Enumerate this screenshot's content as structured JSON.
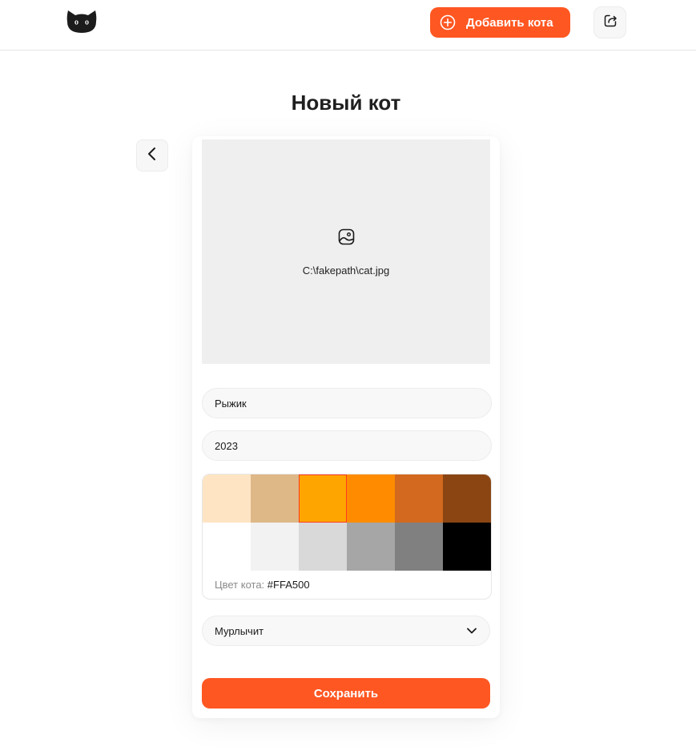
{
  "header": {
    "logo_icon": "cat-head-icon",
    "add_cat_label": "Добавить кота",
    "add_icon": "plus-circle-icon",
    "logout_icon": "share-exit-icon",
    "accent": "#ff5722"
  },
  "page": {
    "title": "Новый кот",
    "back_icon": "chevron-left-icon"
  },
  "form": {
    "photo": {
      "icon": "image-icon",
      "filename": "C:\\fakepath\\cat.jpg"
    },
    "name_value": "Рыжик",
    "year_value": "2023",
    "color": {
      "label": "Цвет кота:",
      "value": "#FFA500",
      "swatches": [
        "#FFE4C4",
        "#DEB887",
        "#FFA500",
        "#FF8C00",
        "#D2691E",
        "#8B4513",
        "#FFFFFF",
        "#F2F2F2",
        "#D9D9D9",
        "#A6A6A6",
        "#808080",
        "#000000"
      ],
      "selected_index": 2
    },
    "temper": {
      "selected": "Мурлычит",
      "icon": "chevron-down-icon"
    },
    "save_label": "Сохранить"
  }
}
